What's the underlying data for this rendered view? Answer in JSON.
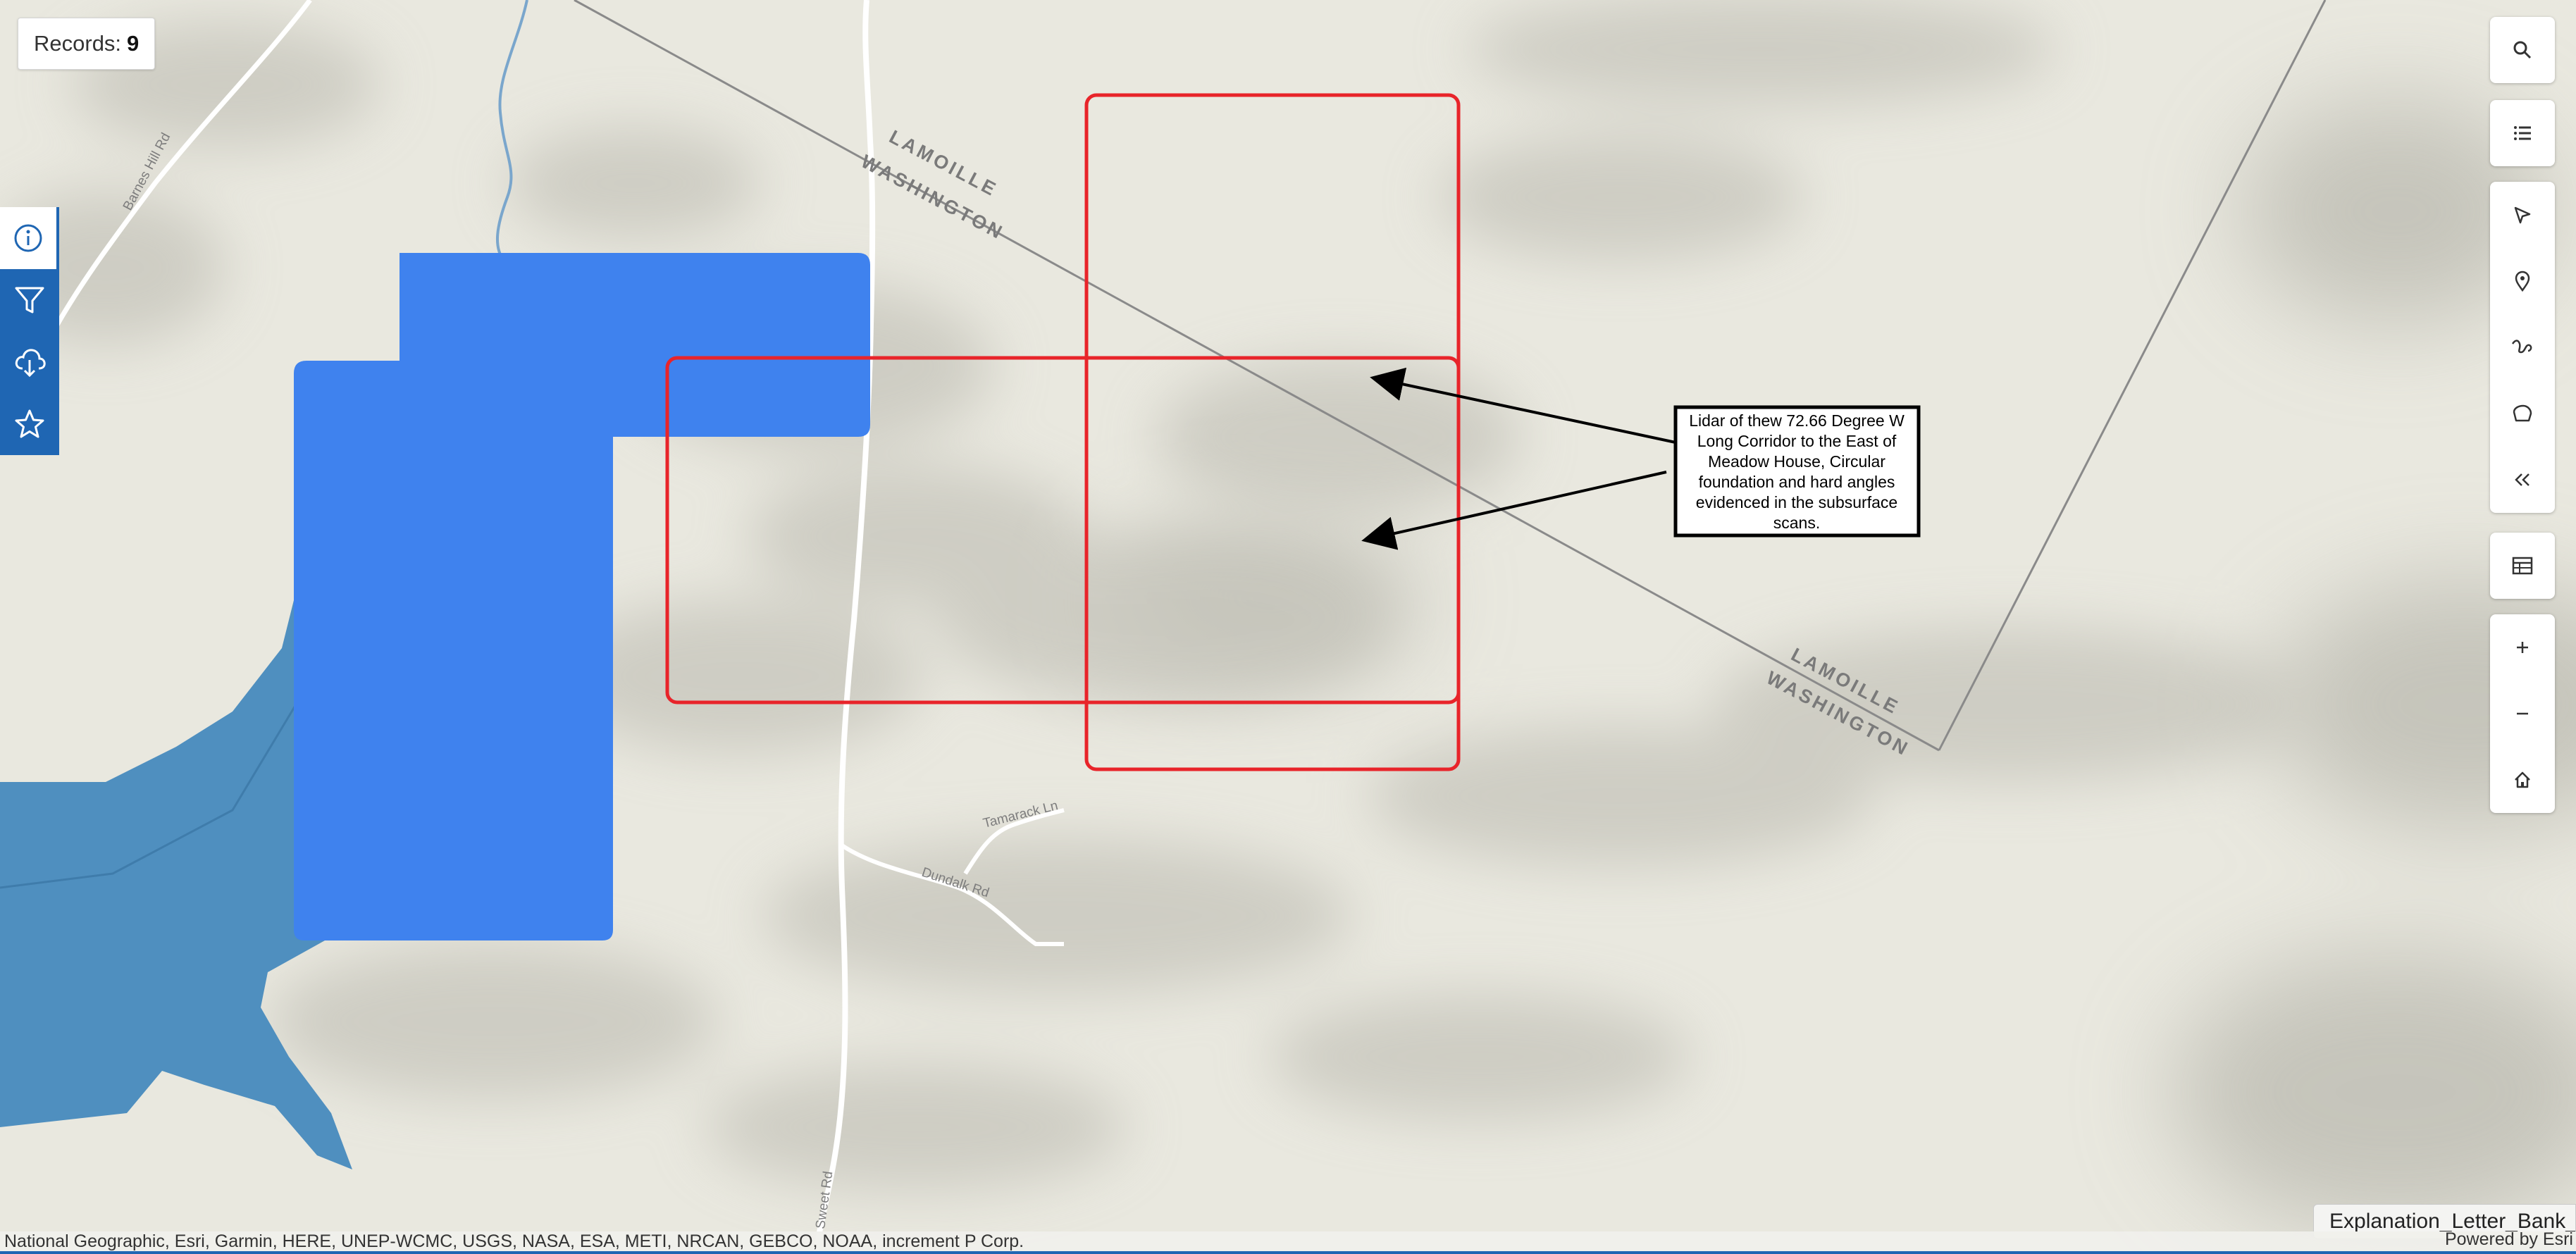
{
  "records": {
    "label": "Records:",
    "count": "9"
  },
  "map_labels": {
    "barnes_hill_rd": "Barnes Hill Rd",
    "tamarack_ln": "Tamarack Ln",
    "dundalk_rd": "Dundalk Rd",
    "sweet_rd": "Sweet Rd",
    "boundary_1_line1": "LAMOILLE",
    "boundary_1_line2": "WASHINGTON",
    "boundary_2_line1": "LAMOILLE",
    "boundary_2_line2": "WASHINGTON"
  },
  "callout": {
    "lines": [
      "Lidar of thew 72.66 Degree W",
      "Long Corridor to the East of",
      "Meadow House, Circular",
      "foundation and hard angles",
      "evidenced in the subsurface",
      "scans."
    ]
  },
  "left_toolbar": [
    {
      "icon": "info-icon",
      "active": true
    },
    {
      "icon": "filter-icon",
      "active": false
    },
    {
      "icon": "cloud-download-icon",
      "active": false
    },
    {
      "icon": "star-icon",
      "active": false
    }
  ],
  "right_toolbar_icons": [
    "search-icon",
    "list-icon",
    "pointer-icon",
    "pin-icon",
    "line-icon",
    "polygon-icon",
    "collapse-icon",
    "table-icon",
    "zoom-in-icon",
    "zoom-out-icon",
    "home-icon"
  ],
  "colors": {
    "basemap": "#e9e8df",
    "water": "#4f8fbf",
    "parcel": "#3f82ee",
    "highlight": "#e8242a",
    "toolbar": "#1f66b3"
  },
  "attribution": "National Geographic, Esri, Garmin, HERE, UNEP-WCMC, USGS, NASA, ESA, METI, NRCAN, GEBCO, NOAA, increment P Corp.",
  "powered_by": "Powered by Esri",
  "layer_chip": "Explanation_Letter_Bank_A"
}
